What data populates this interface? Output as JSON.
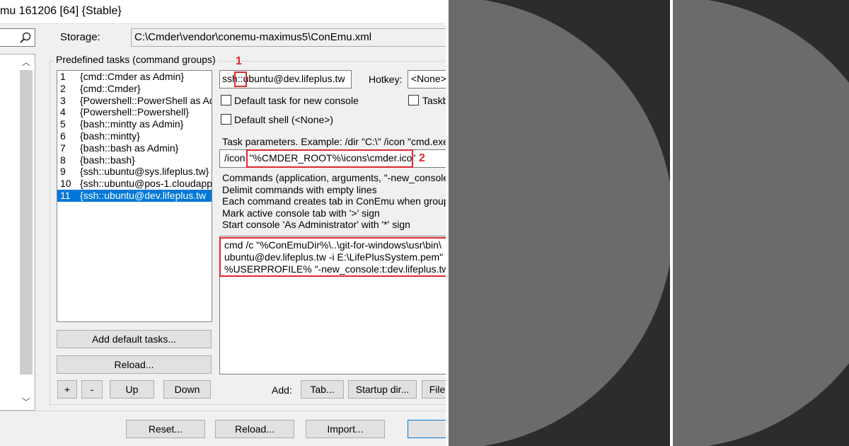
{
  "window": {
    "title": "mu 161206 [64] {Stable}"
  },
  "settings": {
    "storage_label": "Storage:",
    "storage_path": "C:\\Cmder\\vendor\\conemu-maximus5\\ConEmu.xml"
  },
  "tasks": {
    "group_label": "Predefined tasks (command groups)",
    "items": [
      {
        "num": "1",
        "name": "{cmd::Cmder as Admin}"
      },
      {
        "num": "2",
        "name": "{cmd::Cmder}"
      },
      {
        "num": "3",
        "name": "{Powershell::PowerShell as Ad"
      },
      {
        "num": "4",
        "name": "{Powershell::Powershell}"
      },
      {
        "num": "5",
        "name": "{bash::mintty as Admin}"
      },
      {
        "num": "6",
        "name": "{bash::mintty}"
      },
      {
        "num": "7",
        "name": "{bash::bash as Admin}"
      },
      {
        "num": "8",
        "name": "{bash::bash}"
      },
      {
        "num": "9",
        "name": "{ssh::ubuntu@sys.lifeplus.tw}"
      },
      {
        "num": "10",
        "name": "{ssh::ubuntu@pos-1.cloudapp"
      },
      {
        "num": "11",
        "name": "{ssh::ubuntu@dev.lifeplus.tw"
      }
    ],
    "selected_index": 10,
    "add_default_label": "Add default tasks...",
    "reload_label": "Reload...",
    "plus_label": "+",
    "minus_label": "-",
    "up_label": "Up",
    "down_label": "Down"
  },
  "task_editor": {
    "name_prefix": "ssh",
    "name_separator": "::",
    "name_suffix": "ubuntu@dev.lifeplus.tw",
    "hotkey_label": "Hotkey:",
    "hotkey_value": "<None>",
    "default_task_label": "Default task for new console",
    "taskbar_label": "Taskb",
    "default_shell_label": "Default shell (<None>)",
    "params_label": "Task parameters. Example: /dir \"C:\\\" /icon \"cmd.exe",
    "params_prefix": "/icon",
    "params_value": "\"%CMDER_ROOT%\\icons\\cmder.ico\"",
    "info_lines": [
      "Commands (application, arguments, \"-new_console",
      "Delimit commands with empty lines",
      "Each command creates tab in ConEmu when group",
      "Mark active console tab with '>' sign",
      "Start console 'As Administrator' with '*' sign"
    ],
    "command_lines": [
      "cmd /c \"%ConEmuDir%\\..\\git-for-windows\\usr\\bin\\",
      "ubuntu@dev.lifeplus.tw -i E:\\LifePlusSystem.pem\"",
      "%USERPROFILE% \"-new_console:t:dev.lifeplus.tw"
    ],
    "add_label": "Add:",
    "tab_button": "Tab...",
    "startup_dir_button": "Startup dir...",
    "file_button": "File"
  },
  "annotations": {
    "one": "1",
    "two": "2"
  },
  "footer": {
    "reset_label": "Reset...",
    "reload_label": "Reload...",
    "import_label": "Import..."
  },
  "colors": {
    "selection": "#0078d7",
    "annotation_red": "#e0282e",
    "dark_panel": "#2c2c2c",
    "circle_gray": "#6b6b6b"
  }
}
